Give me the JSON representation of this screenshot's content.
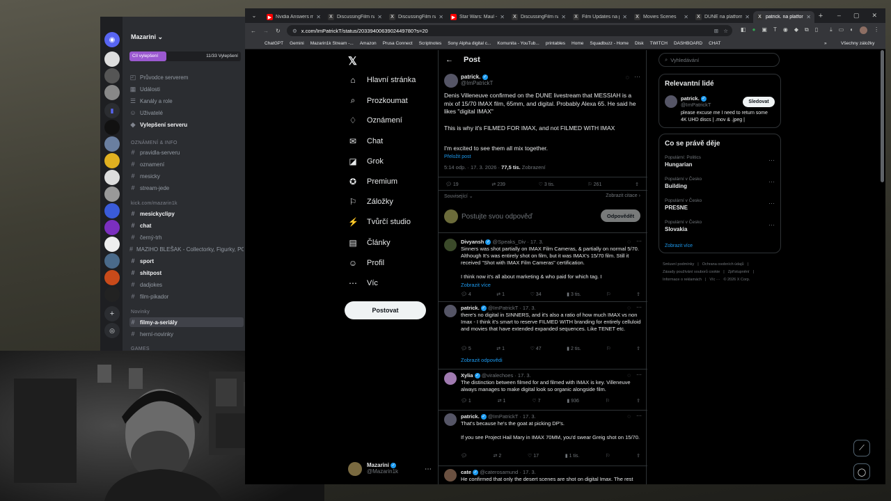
{
  "discord": {
    "server_name": "Mazarini",
    "boost_label": "Cíl vylepšení",
    "boost_count": "11/33 Vylepšení",
    "boost_progress": 0.33,
    "items": [
      {
        "label": "Průvodce serverem",
        "icon": "◰",
        "bold": false
      },
      {
        "label": "Události",
        "icon": "▦",
        "bold": false
      },
      {
        "label": "Kanály a role",
        "icon": "☰",
        "bold": false
      },
      {
        "label": "Uživatelé",
        "icon": "☺",
        "bold": false
      },
      {
        "label": "Vylepšení serveru",
        "icon": "◆",
        "bold": true
      }
    ],
    "cat1": "OZNÁMENÍ & INFO",
    "ch1": [
      "pravidla-serveru",
      "oznamení",
      "mesicky",
      "stream-jede"
    ],
    "cat2": "kick.com/mazarin1k",
    "ch2": [
      {
        "label": "mesickyclipy",
        "bold": true
      },
      {
        "label": "chat",
        "bold": true
      },
      {
        "label": "černý-trh",
        "bold": false
      },
      {
        "label": "MAZIHO BLEŠAK - Collectorky, Figurky, PC, FO...",
        "bold": false
      },
      {
        "label": "sport",
        "bold": true
      },
      {
        "label": "shitpost",
        "bold": true
      },
      {
        "label": "dadjokes",
        "bold": false
      },
      {
        "label": "film-pikador",
        "bold": false
      }
    ],
    "cat3": "Novinky",
    "ch3": [
      {
        "label": "filmy-a-seriály",
        "bold": true
      },
      {
        "label": "herní-novinky",
        "bold": false
      }
    ],
    "cat4": "GAMES"
  },
  "browser": {
    "tabs": [
      "Nvidia Answers my",
      "DiscussingFilm na",
      "DiscussingFilm na p",
      "Star Wars: Maul - S",
      "DiscussingFilm na",
      "Film Updates na pl",
      "Movies Scenes",
      "DUNE na platform",
      "patrick. na platform"
    ],
    "url": "x.com/ImPatrickT/status/2033940063902449780?s=20",
    "bookmarks": [
      "ChatGPT",
      "Gemini",
      "Mazarin1k Stream -...",
      "Amazon",
      "Prusa Connect",
      "Scriptnotes",
      "Sony Alpha digital c...",
      "Komunita - YouTub...",
      "printables",
      "Home",
      "Squadbuzz - Home",
      "Disk",
      "TWITCH",
      "DASHBOARD",
      "CHAT"
    ],
    "all_bookmarks": "Všechny záložky"
  },
  "x": {
    "nav": [
      {
        "label": "Hlavní stránka",
        "icon": "⌂"
      },
      {
        "label": "Prozkoumat",
        "icon": "⌕"
      },
      {
        "label": "Oznámení",
        "icon": "♢"
      },
      {
        "label": "Chat",
        "icon": "✉"
      },
      {
        "label": "Grok",
        "icon": "◪"
      },
      {
        "label": "Premium",
        "icon": "✪"
      },
      {
        "label": "Záložky",
        "icon": "⚐"
      },
      {
        "label": "Tvůrčí studio",
        "icon": "⚡"
      },
      {
        "label": "Články",
        "icon": "▤"
      },
      {
        "label": "Profil",
        "icon": "☺"
      },
      {
        "label": "Víc",
        "icon": "⋯"
      }
    ],
    "post_button": "Postovat",
    "me_name": "Mazarini",
    "me_handle": "@Mazarin1k",
    "header": "Post",
    "post": {
      "name": "patrick.",
      "handle": "@ImPatrickT",
      "p1": "Denis Villeneuve confirmed on the DUNE livestream that MESSIAH is a mix of 15/70 IMAX film, 65mm, and digital. Probably Alexa 65. He said he likes \"digital IMAX\"",
      "p2": "This is why it's FILMED FOR IMAX, and not FILMED WITH IMAX",
      "p3": "I'm excited to see them all mix together.",
      "translate": "Přeložit post",
      "time": "5:14 odp. · 17. 3. 2026 · ",
      "views": "77,5 tis.",
      "views_label": " Zobrazení",
      "replies": "19",
      "reposts": "239",
      "likes": "3 tis.",
      "bookmarks": "261",
      "related": "Související",
      "quotes": "Zobrazit citace",
      "reply_placeholder": "Postujte svou odpověď",
      "reply_btn": "Odpovědět"
    },
    "replies": [
      {
        "name": "Divyansh",
        "handle": "@Speaks_Div · 17. 3.",
        "text": "Sinners was shot partially on IMAX Film Cameras, & partially on normal 5/70. Although It's was entirely shot on film, but it was IMAX's 15/70 film. Still it received \"Shot with IMAX Film Cameras\" certification.\n\nI think now it's all about marketing & who paid for which tag. I",
        "more": "Zobrazit více",
        "r": "4",
        "rt": "1",
        "l": "34",
        "v": "3 tis."
      },
      {
        "name": "patrick.",
        "handle": "@ImPatrickT · 17. 3.",
        "text": "there's no digital in SINNERS, and it's also a ratio of how much IMAX vs non Imax - I think it's smart to reserve FILMED WITH branding for entirely celluloid and movies that have extended expanded sequences. Like TENET etc.",
        "more": "",
        "r": "5",
        "rt": "1",
        "l": "47",
        "v": "2 tis.",
        "showreplies": "Zobrazit odpovědi"
      },
      {
        "name": "Xylia",
        "handle": "@viralechoes · 17. 3.",
        "text": "The distinction between filmed for and filmed with IMAX is key. Villeneuve always manages to make digital look so organic alongside film.",
        "more": "",
        "r": "1",
        "rt": "1",
        "l": "7",
        "v": "936"
      },
      {
        "name": "patrick.",
        "handle": "@ImPatrickT · 17. 3.",
        "text": "That's because he's the goat at picking DP's.\n\nIf you see Project Hail Mary in IMAX 70MM, you'd swear Greig shot on 15/70.",
        "more": "",
        "r": "",
        "rt": "2",
        "l": "17",
        "v": "1 tis."
      },
      {
        "name": "cate",
        "handle": "@caterosamund · 17. 3.",
        "text": "He confirmed that only the desert scenes are shot on digital Imax. The rest",
        "more": "",
        "r": "",
        "rt": "",
        "l": "",
        "v": ""
      }
    ],
    "search_placeholder": "Vyhledávání",
    "relevant_title": "Relevantní lidé",
    "rel_name": "patrick.",
    "rel_handle": "@ImPatrickT",
    "rel_follow": "Sledovat",
    "rel_bio": "please excuse me I need to return some 4K UHD discs | .mov & .jpeg |",
    "trends_title": "Co se právě děje",
    "trends": [
      {
        "cat": "Populární: Politics",
        "name": "Hungarian"
      },
      {
        "cat": "Populární v Česko",
        "name": "Building"
      },
      {
        "cat": "Populární v Česko",
        "name": "PRESNE"
      },
      {
        "cat": "Populární v Česko",
        "name": "Slovakia"
      }
    ],
    "show_more": "Zobrazit více",
    "footer": [
      "Smluvní podmínky",
      "|",
      "Ochrana osobních údajů",
      "|",
      "Zásady používání souborů cookie",
      "|",
      "Zpřístupnění",
      "|",
      "Informace o reklamách",
      "|",
      "Víc ···",
      "© 2026 X Corp."
    ]
  }
}
